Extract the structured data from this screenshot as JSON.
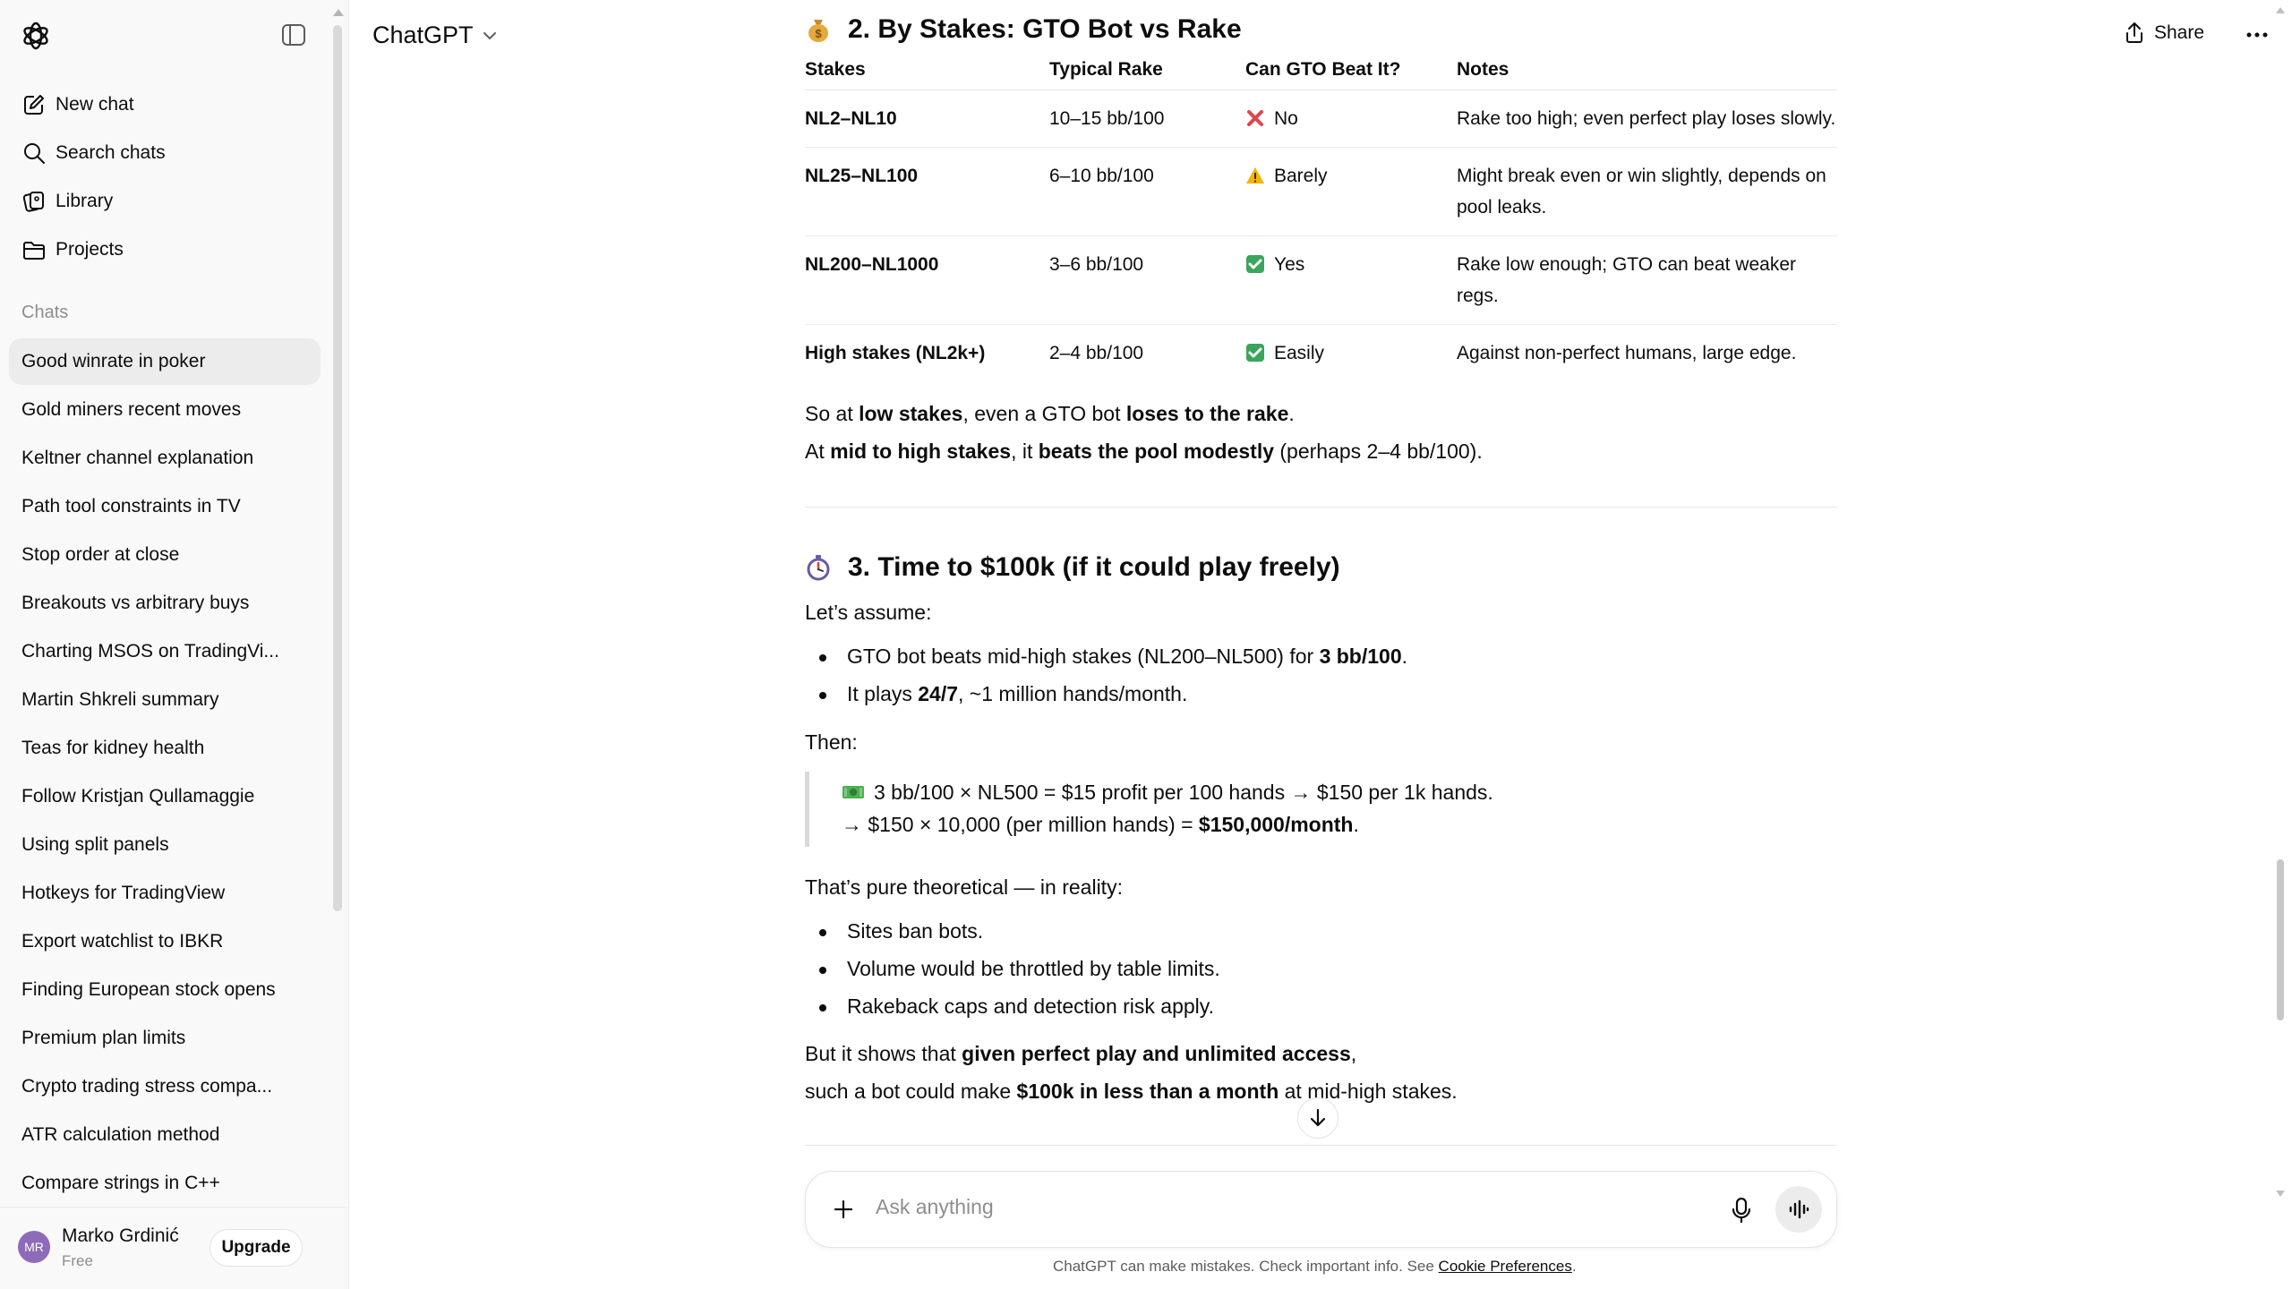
{
  "app": {
    "model_label": "ChatGPT",
    "share_label": "Share"
  },
  "sidebar": {
    "nav": [
      {
        "label": "New chat",
        "icon": "compose-icon"
      },
      {
        "label": "Search chats",
        "icon": "search-icon"
      },
      {
        "label": "Library",
        "icon": "library-icon"
      },
      {
        "label": "Projects",
        "icon": "folder-icon"
      }
    ],
    "chats_label": "Chats",
    "chats": [
      "Good winrate in poker",
      "Gold miners recent moves",
      "Keltner channel explanation",
      "Path tool constraints in TV",
      "Stop order at close",
      "Breakouts vs arbitrary buys",
      "Charting MSOS on TradingVi...",
      "Martin Shkreli summary",
      "Teas for kidney health",
      "Follow Kristjan Qullamaggie",
      "Using split panels",
      "Hotkeys for TradingView",
      "Export watchlist to IBKR",
      "Finding European stock opens",
      "Premium plan limits",
      "Crypto trading stress compa...",
      "ATR calculation method",
      "Compare strings in C++"
    ],
    "active_chat": "Good winrate in poker",
    "user": {
      "initials": "MR",
      "name": "Marko Grdinić",
      "plan": "Free",
      "upgrade_label": "Upgrade"
    }
  },
  "message": {
    "section2": {
      "title": "2. By Stakes: GTO Bot vs Rake",
      "columns": [
        "Stakes",
        "Typical Rake",
        "Can GTO Beat It?",
        "Notes"
      ],
      "rows": [
        {
          "stakes": "NL2–NL10",
          "rake": "10–15 bb/100",
          "verdict": "No",
          "verdict_icon": "cross-icon",
          "notes": "Rake too high; even perfect play loses slowly."
        },
        {
          "stakes": "NL25–NL100",
          "rake": "6–10 bb/100",
          "verdict": "Barely",
          "verdict_icon": "warning-icon",
          "notes_line1": "Might break even or win slightly, depends on",
          "notes_line2": "pool leaks."
        },
        {
          "stakes": "NL200–NL1000",
          "rake": "3–6 bb/100",
          "verdict": "Yes",
          "verdict_icon": "check-icon",
          "notes": "Rake low enough; GTO can beat weaker regs."
        },
        {
          "stakes": "High stakes (NL2k+)",
          "rake": "2–4 bb/100",
          "verdict": "Easily",
          "verdict_icon": "check-icon",
          "notes": "Against non-perfect humans, large edge."
        }
      ],
      "summary1": {
        "a": "So at ",
        "b": "low stakes",
        "c": ", even a GTO bot ",
        "d": "loses to the rake",
        "e": "."
      },
      "summary2": {
        "a": "At ",
        "b": "mid to high stakes",
        "c": ", it ",
        "d": "beats the pool modestly",
        "e": " (perhaps 2–4 bb/100)."
      }
    },
    "section3": {
      "title": "3. Time to $100k (if it could play freely)",
      "intro": "Let’s assume:",
      "bullet1": {
        "a": "GTO bot beats mid-high stakes (NL200–NL500) for ",
        "b": "3 bb/100",
        "c": "."
      },
      "bullet2": {
        "a": "It plays ",
        "b": "24/7",
        "c": ", ~1 million hands/month."
      },
      "then": "Then:",
      "quote_line1": "3 bb/100 × NL500 = $15 profit per 100 hands → $150 per 1k hands.",
      "quote_line2": {
        "a": "→ $150 × 10,000 (per million hands) = ",
        "b": "$150,000/month",
        "c": "."
      },
      "reality_intro": "That’s pure theoretical — in reality:",
      "reality": [
        "Sites ban bots.",
        "Volume would be throttled by table limits.",
        "Rakeback caps and detection risk apply."
      ],
      "conclusion1": {
        "a": "But it shows that ",
        "b": "given perfect play and unlimited access",
        "c": ","
      },
      "conclusion2": {
        "a": "such a bot could make ",
        "b": "$100k in less than a month",
        "c": " at mid-high stakes."
      }
    }
  },
  "composer": {
    "placeholder": "Ask anything"
  },
  "footer": {
    "text": "ChatGPT can make mistakes. Check important info. See ",
    "link": "Cookie Preferences",
    "end": "."
  }
}
